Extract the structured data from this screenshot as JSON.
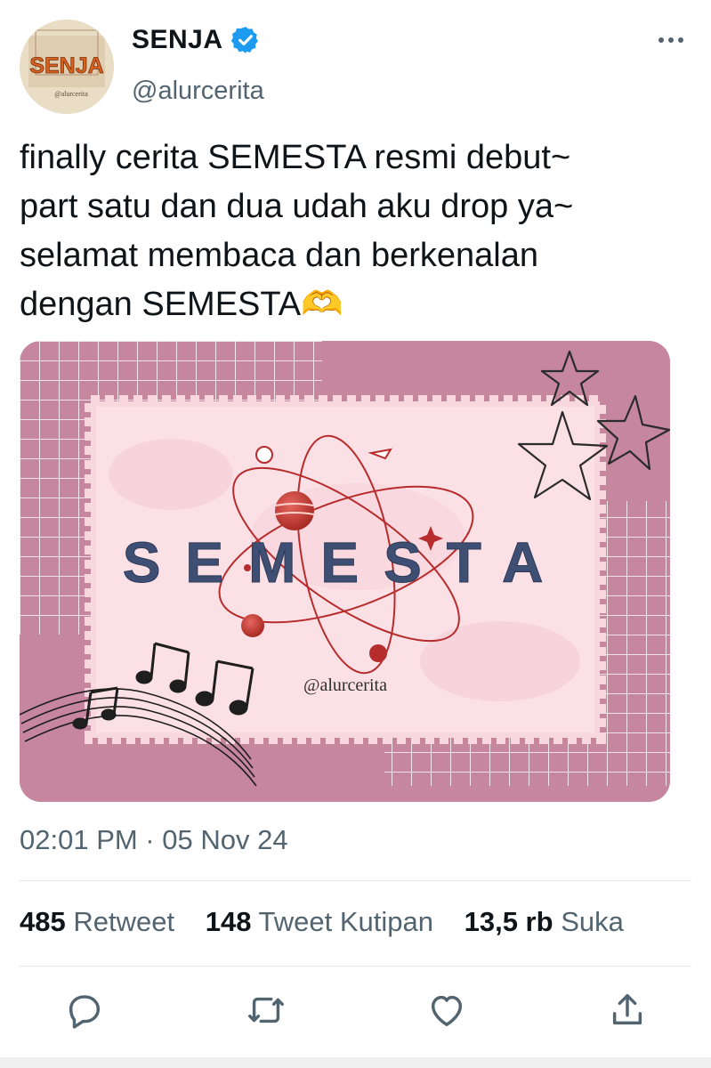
{
  "profile": {
    "display_name": "SENJA",
    "handle": "@alurcerita",
    "avatar_text": "SENJA",
    "avatar_subtext": "@alurcerita"
  },
  "tweet": {
    "lines": [
      "finally cerita SEMESTA resmi debut~",
      "part satu dan dua udah aku drop ya~",
      "selamat membaca dan berkenalan",
      "dengan SEMESTA🫶"
    ]
  },
  "media": {
    "title": "SEMESTA",
    "credit": "@alurcerita"
  },
  "timestamp": "02:01 PM · 05 Nov 24",
  "stats": {
    "retweets": {
      "count": "485",
      "label": "Retweet"
    },
    "quotes": {
      "count": "148",
      "label": "Tweet Kutipan"
    },
    "likes": {
      "count": "13,5 rb",
      "label": "Suka"
    }
  },
  "icons": {
    "verified": "verified-badge-icon",
    "more": "more-icon",
    "reply": "reply-icon",
    "retweet": "retweet-icon",
    "like": "like-icon",
    "share": "share-icon"
  },
  "colors": {
    "verified_blue": "#1d9bf0",
    "secondary_text": "#536471",
    "media_frame": "#c5869e",
    "media_card": "#f8d7df",
    "title_navy": "#3f4f73"
  }
}
